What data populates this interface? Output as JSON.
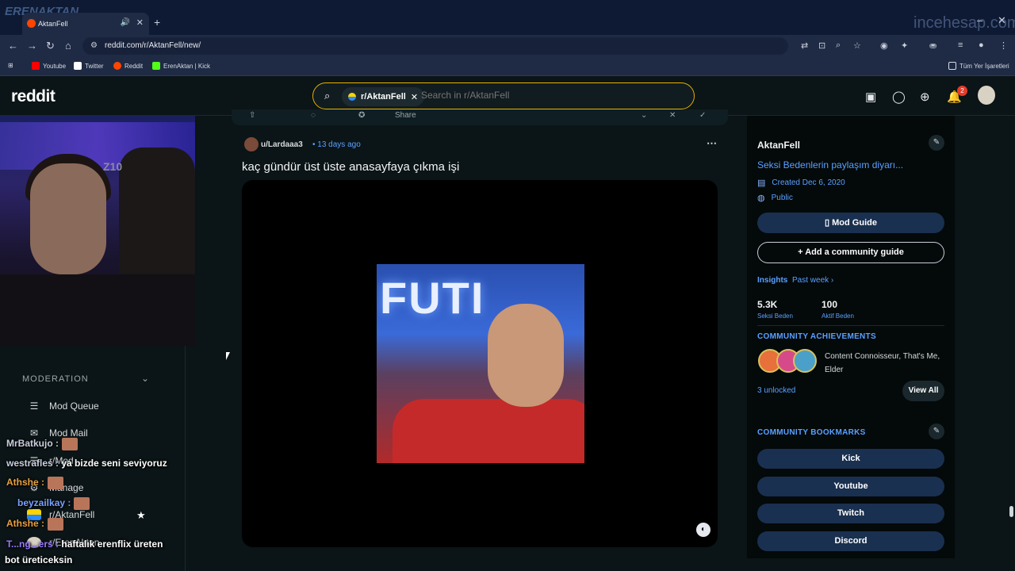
{
  "browser": {
    "tab_title": "AktanFell",
    "url": "reddit.com/r/AktanFell/new/",
    "watermark_left": "ERENAKTAN",
    "watermark_right": "incehesap.com",
    "bookmarks": [
      {
        "label": "Youtube",
        "color": "#ff0000"
      },
      {
        "label": "Twitter",
        "color": "#ffffff"
      },
      {
        "label": "Reddit",
        "color": "#ff4500"
      },
      {
        "label": "ErenAktan | Kick",
        "color": "#53fc18"
      }
    ],
    "all_bookmarks_label": "Tüm Yer İşaretleri"
  },
  "reddit_header": {
    "logo": "reddit",
    "search_chip": "r/AktanFell",
    "search_placeholder": "Search in r/AktanFell",
    "notification_count": "2"
  },
  "left_sidebar": {
    "moderation_heading": "MODERATION",
    "items": [
      {
        "label": "Mod Queue",
        "icon": "queue-icon"
      },
      {
        "label": "Mod Mail",
        "icon": "mail-icon"
      },
      {
        "label": "r/Mod",
        "icon": "mod-icon"
      },
      {
        "label": "Manage",
        "icon": "gear-icon"
      },
      {
        "label": "r/AktanFell",
        "icon": "community-icon"
      },
      {
        "label": "r/ErenAktan",
        "icon": "community-icon"
      }
    ]
  },
  "chat_overlay": {
    "lines": [
      {
        "user": "MrBatkujo :",
        "message": ""
      },
      {
        "user": "westrafles :",
        "message": "ya bizde seni seviyoruz"
      },
      {
        "user": "Athshe :",
        "message": ""
      },
      {
        "user": "beyzailkay :",
        "message": ""
      },
      {
        "user": "Athshe :",
        "message": ""
      },
      {
        "user": "T...ng...ers :",
        "message": "haftalık erenflix üreten"
      },
      {
        "user": "",
        "message": "bot üreticeksin"
      }
    ]
  },
  "post": {
    "author": "u/Lardaaa3",
    "time": "• 13 days ago",
    "title": "kaç gündür üst üste anasayfaya çıkma işi",
    "video_text": "FUTI",
    "action_share": "Share"
  },
  "right_sidebar": {
    "community_name": "AktanFell",
    "description": "Seksi Bedenlerin paylaşım diyarı...",
    "created": "Created Dec 6, 2020",
    "visibility": "Public",
    "mod_guide_label": "Mod Guide",
    "add_guide_label": "Add a community guide",
    "insights_label": "Insights",
    "insights_period": "Past week ›",
    "stats": [
      {
        "value": "5.3K",
        "label": "Seksi Beden"
      },
      {
        "value": "100",
        "label": "Aktif Beden"
      }
    ],
    "achievements_heading": "COMMUNITY ACHIEVEMENTS",
    "achievements_text": "Content Connoisseur, That's Me, Elder",
    "unlocked": "3 unlocked",
    "view_all": "View All",
    "bookmarks_heading": "COMMUNITY BOOKMARKS",
    "bookmarks": [
      "Kick",
      "Youtube",
      "Twitch",
      "Discord"
    ]
  }
}
